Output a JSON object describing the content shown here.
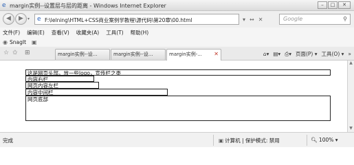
{
  "window": {
    "title": "margin实例--设置层与层的距离 - Windows Internet Explorer",
    "controls": [
      "–",
      "□",
      "✕"
    ]
  },
  "address": {
    "url": "F:\\lelning\\HTML+CSS商业案例学教程\\源代码\\第20章\\00.html",
    "tools": [
      "▾",
      "↔",
      "✕"
    ],
    "search_placeholder": "Google"
  },
  "menu": [
    "文件(F)",
    "编辑(E)",
    "查看(V)",
    "收藏夹(A)",
    "工具(T)",
    "帮助(H)"
  ],
  "favorites": {
    "snagit_label": "SnagIt"
  },
  "tabs": [
    {
      "label": "margin实例--设..."
    },
    {
      "label": "margin实例--设..."
    },
    {
      "label": "margin实例-..."
    }
  ],
  "command_bar": {
    "page_label": "页面(P) ▾",
    "tools_label": "工具(O) ▾"
  },
  "page": {
    "header": "这是网页头部，放一些logo，宣传栏之类",
    "right_col": "内容右栏",
    "left_col": "网页内容左栏",
    "main_col": "内容中间栏",
    "footer": "网页底部"
  },
  "status": {
    "text": "完成",
    "zone": "计算机 | 保护模式: 禁用",
    "zoom": "100%"
  }
}
